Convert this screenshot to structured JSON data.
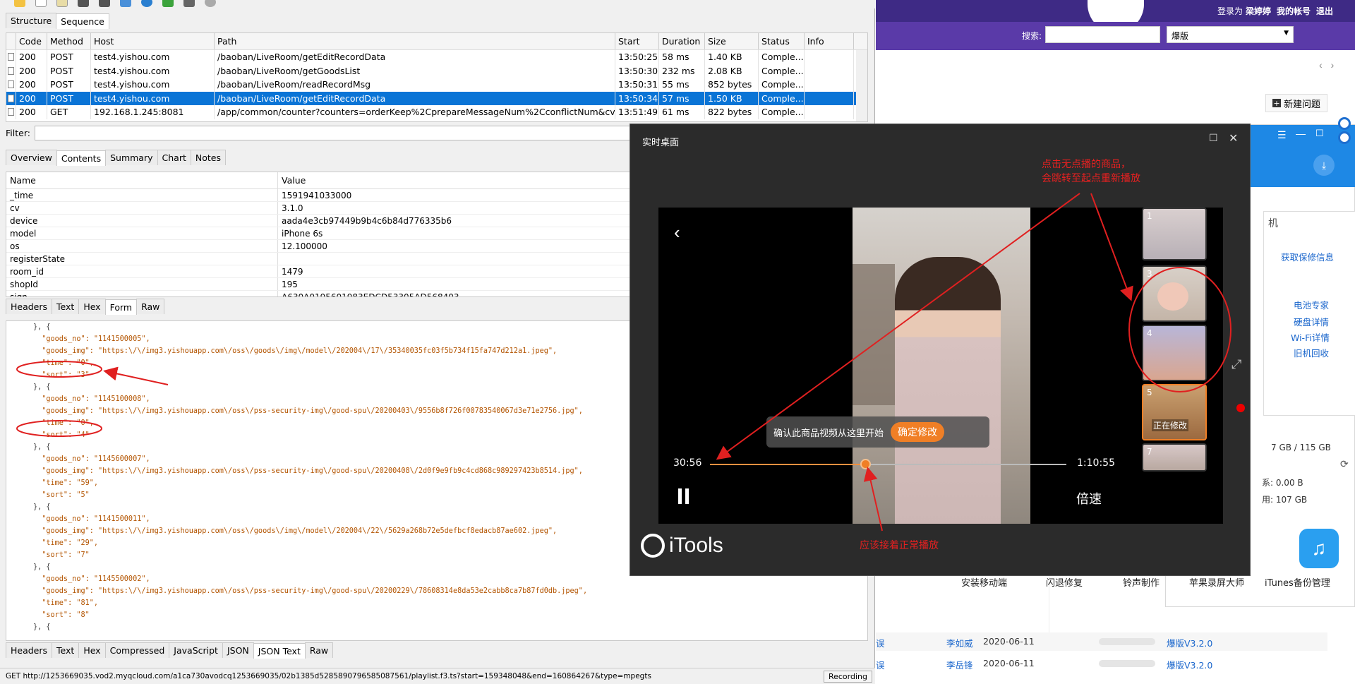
{
  "charles": {
    "top_tabs": [
      "Structure",
      "Sequence"
    ],
    "columns": [
      "Code",
      "Method",
      "Host",
      "Path",
      "Start",
      "Duration",
      "Size",
      "Status",
      "Info"
    ],
    "rows": [
      {
        "code": "200",
        "method": "POST",
        "host": "test4.yishou.com",
        "path": "/baoban/LiveRoom/getEditRecordData",
        "start": "13:50:25",
        "duration": "58 ms",
        "size": "1.40 KB",
        "status": "Comple..."
      },
      {
        "code": "200",
        "method": "POST",
        "host": "test4.yishou.com",
        "path": "/baoban/LiveRoom/getGoodsList",
        "start": "13:50:30",
        "duration": "232 ms",
        "size": "2.08 KB",
        "status": "Comple..."
      },
      {
        "code": "200",
        "method": "POST",
        "host": "test4.yishou.com",
        "path": "/baoban/LiveRoom/readRecordMsg",
        "start": "13:50:31",
        "duration": "55 ms",
        "size": "852 bytes",
        "status": "Comple..."
      },
      {
        "code": "200",
        "method": "POST",
        "host": "test4.yishou.com",
        "path": "/baoban/LiveRoom/getEditRecordData",
        "start": "13:50:34",
        "duration": "57 ms",
        "size": "1.50 KB",
        "status": "Comple..."
      },
      {
        "code": "200",
        "method": "GET",
        "host": "192.168.1.245:8081",
        "path": "/app/common/counter?counters=orderKeep%2CprepareMessageNum%2CconflictNum&cv=3....",
        "start": "13:51:49",
        "duration": "61 ms",
        "size": "822 bytes",
        "status": "Comple..."
      }
    ],
    "filter_label": "Filter:",
    "detail_tabs": [
      "Overview",
      "Contents",
      "Summary",
      "Chart",
      "Notes"
    ],
    "form_columns": [
      "Name",
      "Value"
    ],
    "form_rows": [
      {
        "name": "_time",
        "value": "1591941033000"
      },
      {
        "name": "cv",
        "value": "3.1.0"
      },
      {
        "name": "device",
        "value": "aada4e3cb97449b9b4c6b84d776335b6"
      },
      {
        "name": "model",
        "value": "iPhone 6s"
      },
      {
        "name": "os",
        "value": "12.100000"
      },
      {
        "name": "registerState",
        "value": ""
      },
      {
        "name": "room_id",
        "value": "1479"
      },
      {
        "name": "shopId",
        "value": "195"
      },
      {
        "name": "sign",
        "value": "A630A0195601983EDCD53305AD568403"
      }
    ],
    "request_tabs": [
      "Headers",
      "Text",
      "Hex",
      "Form",
      "Raw"
    ],
    "json_lines": [
      "}, {",
      "  \"goods_no\": \"1141500005\",",
      "  \"goods_img\": \"https:\\/\\/img3.yishouapp.com\\/oss\\/goods\\/img\\/model\\/202004\\/17\\/35340035fc03f5b734f15fa747d212a1.jpeg\",",
      "  \"time\": \"0\",",
      "  \"sort\": \"3\"",
      "}, {",
      "  \"goods_no\": \"1145100008\",",
      "  \"goods_img\": \"https:\\/\\/img3.yishouapp.com\\/oss\\/pss-security-img\\/good-spu\\/20200403\\/9556b8f726f00783540067d3e71e2756.jpg\",",
      "  \"time\": \"0\",",
      "  \"sort\": \"4\"",
      "}, {",
      "  \"goods_no\": \"1145600007\",",
      "  \"goods_img\": \"https:\\/\\/img3.yishouapp.com\\/oss\\/pss-security-img\\/good-spu\\/20200408\\/2d0f9e9fb9c4cd868c989297423b8514.jpg\",",
      "  \"time\": \"59\",",
      "  \"sort\": \"5\"",
      "}, {",
      "  \"goods_no\": \"1141500011\",",
      "  \"goods_img\": \"https:\\/\\/img3.yishouapp.com\\/oss\\/goods\\/img\\/model\\/202004\\/22\\/5629a268b72e5defbcf8edacb87ae602.jpeg\",",
      "  \"time\": \"29\",",
      "  \"sort\": \"7\"",
      "}, {",
      "  \"goods_no\": \"1145500002\",",
      "  \"goods_img\": \"https:\\/\\/img3.yishouapp.com\\/oss\\/pss-security-img\\/good-spu\\/20200229\\/78608314e8da53e2cabb8ca7b87fd0db.jpeg\",",
      "  \"time\": \"81\",",
      "  \"sort\": \"8\"",
      "}, {"
    ],
    "response_tabs": [
      "Headers",
      "Text",
      "Hex",
      "Compressed",
      "JavaScript",
      "JSON",
      "JSON Text",
      "Raw"
    ],
    "status_url": "GET http://1253669035.vod2.myqcloud.com/a1ca730avodcq1253669035/02b1385d5285890796585087561/playlist.f3.ts?start=159348048&end=160864267&type=mpegts",
    "recording": "Recording"
  },
  "webpage": {
    "login_text": "登录为",
    "username": "梁婷婷",
    "my_account": "我的帐号",
    "logout": "退出",
    "search_label": "搜索:",
    "search_select": "爆版",
    "new_issue_button": "新建问题",
    "rows": [
      {
        "prefix": "误",
        "person": "李如威",
        "date": "2020-06-11",
        "version": "爆版V3.2.0"
      },
      {
        "prefix": "误",
        "person": "李岳锋",
        "date": "2020-06-11",
        "version": "爆版V3.2.0"
      }
    ]
  },
  "itools_app": {
    "panel_title": "机",
    "links": [
      "获取保修信息",
      "电池专家",
      "硬盘详情",
      "Wi-Fi详情",
      "旧机回收"
    ],
    "storage": "7 GB / 115 GB",
    "stat1": "系: 0.00 B",
    "stat2": "用: 107 GB",
    "bottom_items": [
      "安装移动端",
      "闪退修复",
      "铃声制作",
      "苹果录屏大师",
      "iTunes备份管理"
    ]
  },
  "popup": {
    "title": "实时桌面",
    "thumb_numbers": [
      "1",
      "3",
      "4",
      "5",
      "7"
    ],
    "editing_label": "正在修改",
    "confirm_text": "确认此商品视频从这里开始",
    "confirm_button": "确定修改",
    "time_current": "30:56",
    "time_total": "1:10:55",
    "progress_fraction": 0.435,
    "speed_label": "倍速",
    "logo_text": "iTools"
  },
  "annotations": {
    "top_note_line1": "点击无点播的商品，",
    "top_note_line2": "会跳转至起点重新播放",
    "bottom_note": "应该接着正常播放"
  }
}
